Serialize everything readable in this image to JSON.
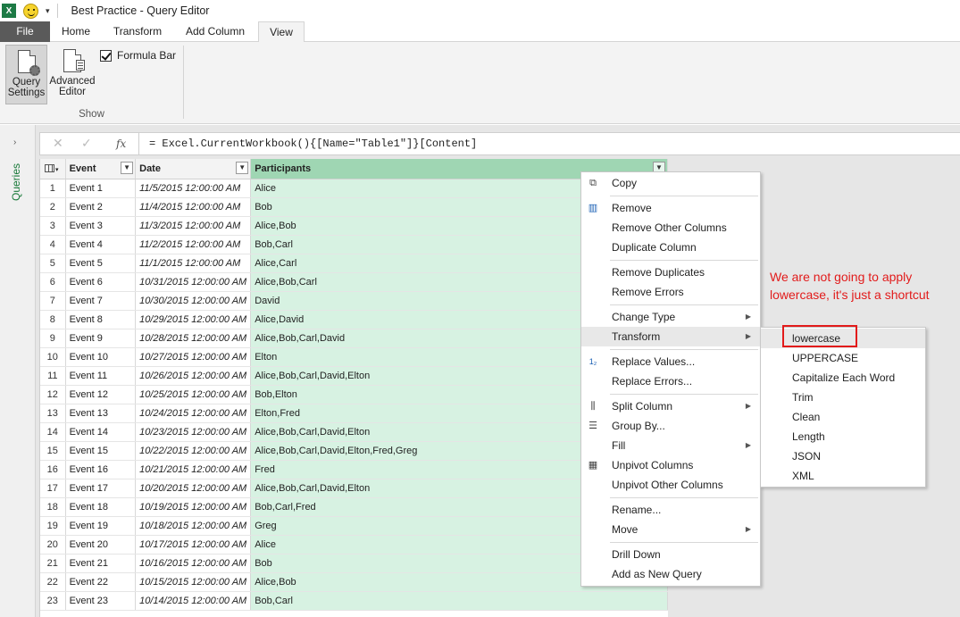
{
  "window": {
    "title": "Best Practice - Query Editor",
    "app_icon": "X",
    "qat_arrow": "▾"
  },
  "tabs": [
    "File",
    "Home",
    "Transform",
    "Add Column",
    "View"
  ],
  "ribbon": {
    "query_settings_line1": "Query",
    "query_settings_line2": "Settings",
    "advanced_editor_line1": "Advanced",
    "advanced_editor_line2": "Editor",
    "formula_bar_label": "Formula Bar",
    "formula_bar_checked": true,
    "group_label": "Show"
  },
  "query_pane": {
    "label": "Queries",
    "chevron": "›"
  },
  "formula_bar": {
    "cancel": "✕",
    "commit": "✓",
    "fx": "fx",
    "formula": "= Excel.CurrentWorkbook(){[Name=\"Table1\"]}[Content]"
  },
  "grid": {
    "columns": [
      "Event",
      "Date",
      "Participants"
    ],
    "rows": [
      [
        "1",
        "Event 1",
        "11/5/2015 12:00:00 AM",
        "Alice"
      ],
      [
        "2",
        "Event 2",
        "11/4/2015 12:00:00 AM",
        "Bob"
      ],
      [
        "3",
        "Event 3",
        "11/3/2015 12:00:00 AM",
        "Alice,Bob"
      ],
      [
        "4",
        "Event 4",
        "11/2/2015 12:00:00 AM",
        "Bob,Carl"
      ],
      [
        "5",
        "Event 5",
        "11/1/2015 12:00:00 AM",
        "Alice,Carl"
      ],
      [
        "6",
        "Event 6",
        "10/31/2015 12:00:00 AM",
        "Alice,Bob,Carl"
      ],
      [
        "7",
        "Event 7",
        "10/30/2015 12:00:00 AM",
        "David"
      ],
      [
        "8",
        "Event 8",
        "10/29/2015 12:00:00 AM",
        "Alice,David"
      ],
      [
        "9",
        "Event 9",
        "10/28/2015 12:00:00 AM",
        "Alice,Bob,Carl,David"
      ],
      [
        "10",
        "Event 10",
        "10/27/2015 12:00:00 AM",
        "Elton"
      ],
      [
        "11",
        "Event 11",
        "10/26/2015 12:00:00 AM",
        "Alice,Bob,Carl,David,Elton"
      ],
      [
        "12",
        "Event 12",
        "10/25/2015 12:00:00 AM",
        "Bob,Elton"
      ],
      [
        "13",
        "Event 13",
        "10/24/2015 12:00:00 AM",
        "Elton,Fred"
      ],
      [
        "14",
        "Event 14",
        "10/23/2015 12:00:00 AM",
        "Alice,Bob,Carl,David,Elton"
      ],
      [
        "15",
        "Event 15",
        "10/22/2015 12:00:00 AM",
        "Alice,Bob,Carl,David,Elton,Fred,Greg"
      ],
      [
        "16",
        "Event 16",
        "10/21/2015 12:00:00 AM",
        "Fred"
      ],
      [
        "17",
        "Event 17",
        "10/20/2015 12:00:00 AM",
        "Alice,Bob,Carl,David,Elton"
      ],
      [
        "18",
        "Event 18",
        "10/19/2015 12:00:00 AM",
        "Bob,Carl,Fred"
      ],
      [
        "19",
        "Event 19",
        "10/18/2015 12:00:00 AM",
        "Greg"
      ],
      [
        "20",
        "Event 20",
        "10/17/2015 12:00:00 AM",
        "Alice"
      ],
      [
        "21",
        "Event 21",
        "10/16/2015 12:00:00 AM",
        "Bob"
      ],
      [
        "22",
        "Event 22",
        "10/15/2015 12:00:00 AM",
        "Alice,Bob"
      ],
      [
        "23",
        "Event 23",
        "10/14/2015 12:00:00 AM",
        "Bob,Carl"
      ]
    ]
  },
  "context_menu": {
    "items": [
      {
        "label": "Copy",
        "icon": "copy-icon"
      },
      {
        "label": "Remove",
        "icon": "remove-columns-icon"
      },
      {
        "label": "Remove Other Columns"
      },
      {
        "label": "Duplicate Column"
      },
      {
        "label": "Remove Duplicates"
      },
      {
        "label": "Remove Errors"
      },
      {
        "label": "Change Type",
        "submenu": true
      },
      {
        "label": "Transform",
        "submenu": true,
        "highlighted": true
      },
      {
        "label": "Replace Values...",
        "icon": "replace-values-icon"
      },
      {
        "label": "Replace Errors..."
      },
      {
        "label": "Split Column",
        "submenu": true,
        "icon": "split-column-icon"
      },
      {
        "label": "Group By...",
        "icon": "group-by-icon"
      },
      {
        "label": "Fill",
        "submenu": true
      },
      {
        "label": "Unpivot Columns",
        "icon": "unpivot-icon"
      },
      {
        "label": "Unpivot Other Columns"
      },
      {
        "label": "Rename..."
      },
      {
        "label": "Move",
        "submenu": true
      },
      {
        "label": "Drill Down"
      },
      {
        "label": "Add as New Query"
      }
    ]
  },
  "transform_submenu": {
    "items": [
      "lowercase",
      "UPPERCASE",
      "Capitalize Each Word",
      "Trim",
      "Clean",
      "Length",
      "JSON",
      "XML"
    ],
    "highlighted": "lowercase"
  },
  "annotation": {
    "text": "We are not going to apply lowercase, it's just a shortcut",
    "color": "#e21b1b"
  },
  "colors": {
    "accent_green": "#1a7a3a",
    "selected_header": "#9fd6b3",
    "selected_column": "#d7f2e2",
    "file_tab": "#5a5a5a"
  }
}
